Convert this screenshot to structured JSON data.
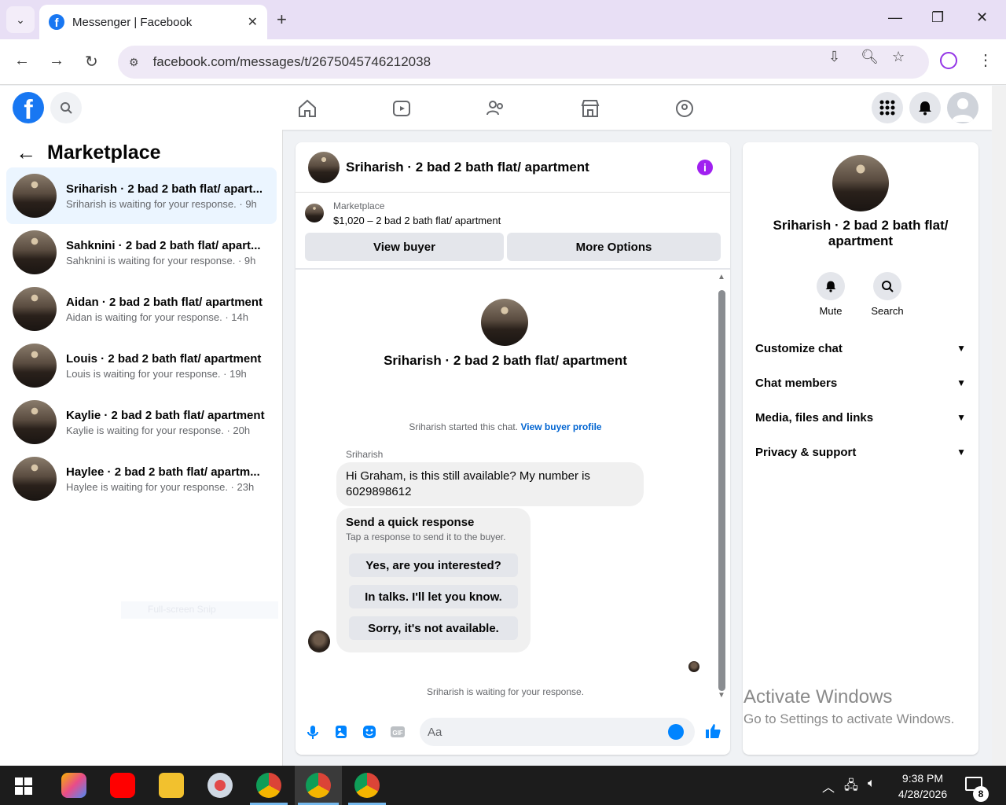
{
  "browser": {
    "tab_title": "Messenger | Facebook",
    "url": "facebook.com/messages/t/2675045746212038"
  },
  "sidebar": {
    "title": "Marketplace",
    "conversations": [
      {
        "name": "Sriharish · 2 bad 2 bath flat/ apart...",
        "sub": "Sriharish is waiting for your response. · 9h",
        "active": true
      },
      {
        "name": "Sahknini · 2 bad 2 bath flat/ apart...",
        "sub": "Sahknini is waiting for your response. · 9h",
        "active": false
      },
      {
        "name": "Aidan · 2 bad 2 bath flat/ apartment",
        "sub": "Aidan is waiting for your response. · 14h",
        "active": false
      },
      {
        "name": "Louis · 2 bad 2 bath flat/ apartment",
        "sub": "Louis is waiting for your response. · 19h",
        "active": false
      },
      {
        "name": "Kaylie · 2 bad 2 bath flat/ apartment",
        "sub": "Kaylie is waiting for your response. · 20h",
        "active": false
      },
      {
        "name": "Haylee · 2 bad 2 bath flat/ apartm...",
        "sub": "Haylee is waiting for your response. · 23h",
        "active": false
      }
    ],
    "ghost_text": "Full-screen Snip"
  },
  "chat": {
    "title": "Sriharish · 2 bad 2 bath flat/ apartment",
    "marketplace_label": "Marketplace",
    "listing": "$1,020 – 2 bad 2 bath flat/ apartment",
    "view_buyer": "View buyer",
    "more_options": "More Options",
    "intro_title": "Sriharish · 2 bad 2 bath flat/ apartment",
    "started_text": "Sriharish started this chat.",
    "view_buyer_profile": "View buyer profile",
    "sender_name": "Sriharish",
    "message": "Hi Graham, is this still available? My number is 6029898612",
    "quick_title": "Send a quick response",
    "quick_sub": "Tap a response to send it to the buyer.",
    "quick_replies": [
      "Yes, are you interested?",
      "In talks. I'll let you know.",
      "Sorry, it's not available."
    ],
    "waiting": "Sriharish is waiting for your response.",
    "composer_placeholder": "Aa"
  },
  "details": {
    "title": "Sriharish · 2 bad 2 bath flat/ apartment",
    "mute": "Mute",
    "search": "Search",
    "sections": [
      "Customize chat",
      "Chat members",
      "Media, files and links",
      "Privacy & support"
    ]
  },
  "watermark": {
    "line1": "Activate Windows",
    "line2": "Go to Settings to activate Windows."
  },
  "taskbar": {
    "time": "9:38 PM",
    "date": "4/28/2026",
    "notifications": "8"
  },
  "colors": {
    "fb_blue": "#1877f2",
    "messenger_blue": "#0084ff",
    "active_conv_bg": "#ebf5ff",
    "info_purple": "#a020f0"
  }
}
